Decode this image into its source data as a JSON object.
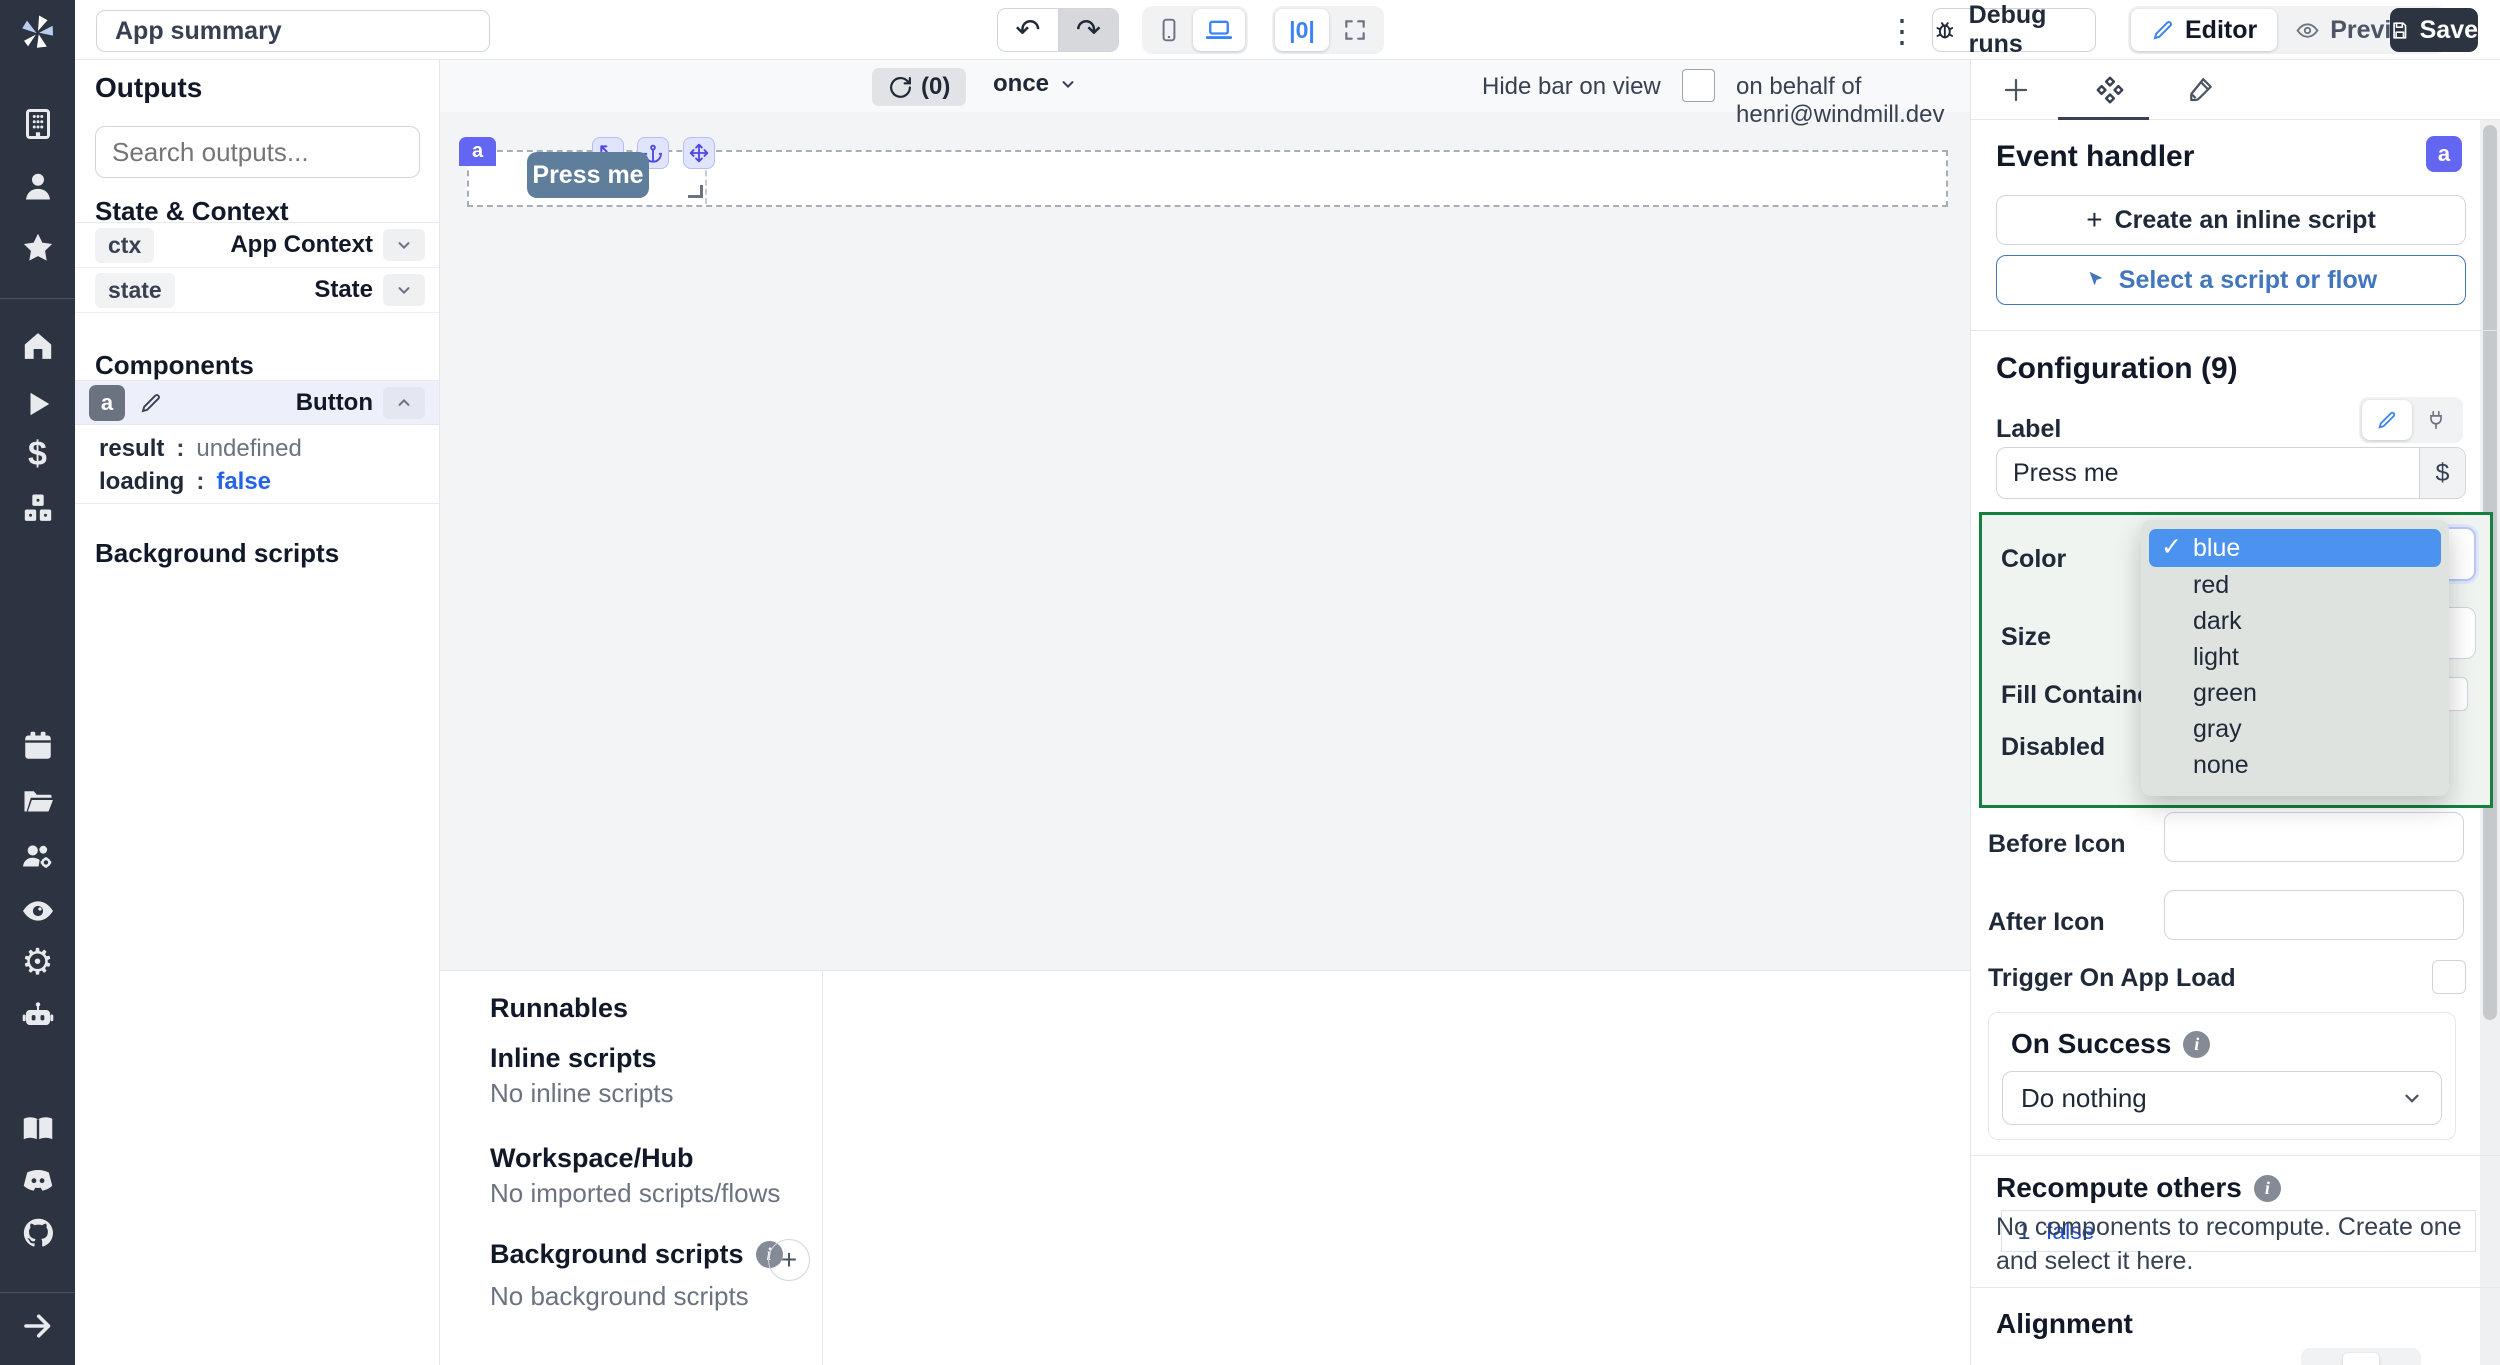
{
  "colors": {
    "accent_indigo": "#6366f1",
    "accent_blue": "#3b82f6",
    "link_blue": "#4277bd",
    "selected_option_bg": "#4b93ee",
    "config_highlight_green": "#15803d",
    "canvas_button_bg": "#5f7e9c",
    "dark_navy": "#2b3440",
    "loading_false_blue": "#2563eb"
  },
  "icons": {
    "undo": "↶",
    "redo": "↷",
    "kebab": "⋮",
    "check": "✓",
    "plus": "+",
    "gear": "⚙",
    "dollar": "$",
    "center_mode": "|0|",
    "info": "i"
  },
  "header": {
    "app_title_value": "App summary",
    "debug_runs_label": "Debug runs",
    "editor_label": "Editor",
    "preview_label": "Preview",
    "save_label": "Save"
  },
  "outputs": {
    "title": "Outputs",
    "search_placeholder": "Search outputs...",
    "state_context_title": "State & Context",
    "rows": [
      {
        "key": "ctx",
        "type": "App Context"
      },
      {
        "key": "state",
        "type": "State"
      }
    ],
    "components_title": "Components",
    "component": {
      "id": "a",
      "type": "Button"
    },
    "separator": ":",
    "props": [
      {
        "key": "result",
        "value": "undefined"
      },
      {
        "key": "loading",
        "value": "false"
      }
    ],
    "background_scripts_title": "Background scripts"
  },
  "canvas": {
    "refresh_count": "(0)",
    "schedule": "once",
    "hide_bar_label": "Hide bar on view",
    "on_behalf_label": "on behalf of henri@windmill.dev",
    "component_id": "a",
    "button_label": "Press me"
  },
  "runnables": {
    "title": "Runnables",
    "inline_scripts_title": "Inline scripts",
    "inline_scripts_empty": "No inline scripts",
    "workspace_hub_title": "Workspace/Hub",
    "workspace_hub_empty": "No imported scripts/flows",
    "background_scripts_title": "Background scripts",
    "background_scripts_empty": "No background scripts"
  },
  "settings": {
    "event_handler_title": "Event handler",
    "badge": "a",
    "create_inline_script_label": "Create an inline script",
    "select_script_label": "Select a script or flow",
    "configuration_title": "Configuration (9)",
    "label_field_label": "Label",
    "label_field_value": "Press me",
    "color_label": "Color",
    "size_label": "Size",
    "fill_container_label": "Fill Container",
    "disabled_label": "Disabled",
    "disabled_line_number": "1",
    "disabled_value": "false",
    "color_options": [
      {
        "label": "blue",
        "selected": true
      },
      {
        "label": "red"
      },
      {
        "label": "dark"
      },
      {
        "label": "light"
      },
      {
        "label": "green"
      },
      {
        "label": "gray"
      },
      {
        "label": "none"
      }
    ],
    "before_icon_label": "Before Icon",
    "after_icon_label": "After Icon",
    "trigger_on_app_load_label": "Trigger On App Load",
    "on_success_title": "On Success",
    "on_success_value": "Do nothing",
    "recompute_others_title": "Recompute others",
    "recompute_others_description": "No components to recompute. Create one and select it here.",
    "alignment_title": "Alignment"
  }
}
